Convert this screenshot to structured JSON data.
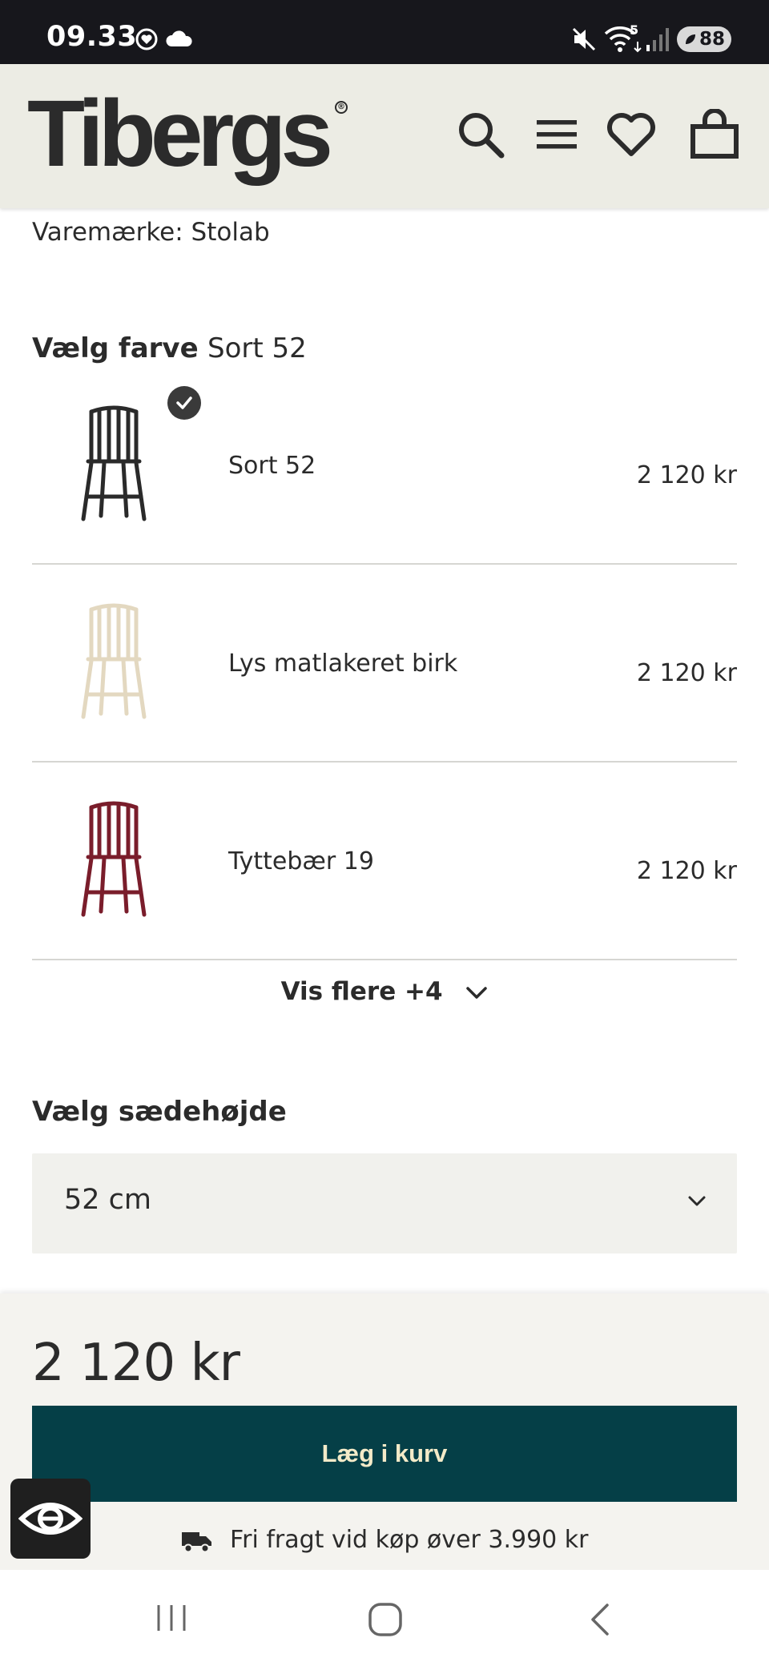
{
  "status_bar": {
    "time": "09.33",
    "battery": "88",
    "network_badge": "5"
  },
  "header": {
    "logo": "Tibergs",
    "logo_mark": "®",
    "icons": [
      "search-icon",
      "menu-icon",
      "heart-icon",
      "cart-icon"
    ]
  },
  "product": {
    "brand_line": "Varemærke: Stolab",
    "color_section_label": "Vælg farve",
    "selected_color": "Sort 52",
    "colors": [
      {
        "name": "Sort 52",
        "price": "2 120 kr",
        "swatch": "#2a2a2a",
        "selected": true
      },
      {
        "name": "Lys matlakeret birk",
        "price": "2 120 kr",
        "swatch": "#e6dcc6",
        "selected": false
      },
      {
        "name": "Tyttebær 19",
        "price": "2 120 kr",
        "swatch": "#7a1d2b",
        "selected": false
      }
    ],
    "show_more": "Vis flere +4",
    "height_section_label": "Vælg sædehøjde",
    "height_value": "52 cm"
  },
  "buy_bar": {
    "price": "2 120 kr",
    "add_to_cart": "Læg i kurv",
    "free_shipping": "Fri fragt vid køp øver 3.990 kr"
  },
  "colors": {
    "header_bg": "#ecece4",
    "cta_bg": "#053f47",
    "cta_text": "#f3eac8"
  }
}
